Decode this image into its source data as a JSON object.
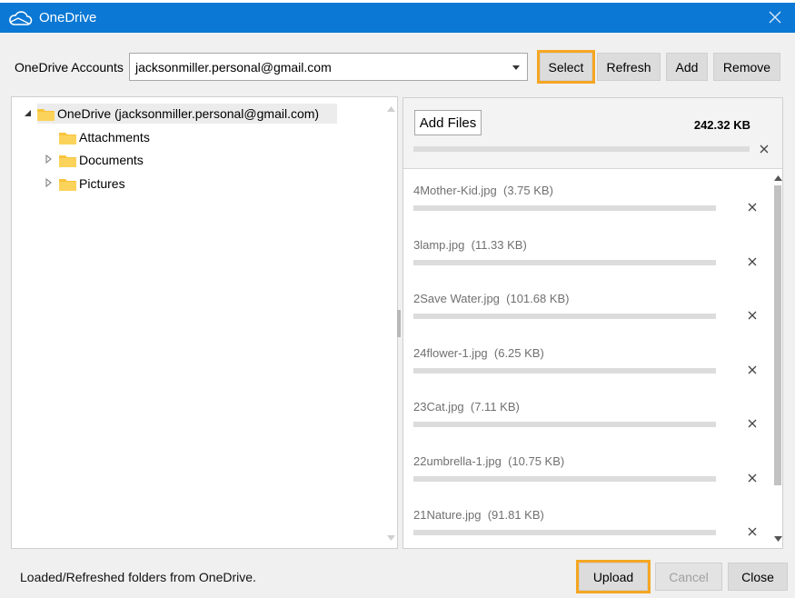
{
  "window": {
    "title": "OneDrive",
    "icon": "cloud-icon",
    "close_icon": "close-icon"
  },
  "accounts": {
    "label": "OneDrive Accounts",
    "selected": "jacksonmiller.personal@gmail.com",
    "buttons": {
      "select": "Select",
      "refresh": "Refresh",
      "add": "Add",
      "remove": "Remove"
    }
  },
  "tree": {
    "root": "OneDrive (jacksonmiller.personal@gmail.com)",
    "children": [
      "Attachments",
      "Documents",
      "Pictures"
    ]
  },
  "upload_panel": {
    "add_files_label": "Add Files",
    "total_size": "242.32 KB",
    "files": [
      {
        "name": "4Mother-Kid.jpg",
        "size": "(3.75 KB)"
      },
      {
        "name": "3lamp.jpg",
        "size": "(11.33 KB)"
      },
      {
        "name": "2Save Water.jpg",
        "size": "(101.68 KB)"
      },
      {
        "name": "24flower-1.jpg",
        "size": "(6.25 KB)"
      },
      {
        "name": "23Cat.jpg",
        "size": "(7.11 KB)"
      },
      {
        "name": "22umbrella-1.jpg",
        "size": "(10.75 KB)"
      },
      {
        "name": "21Nature.jpg",
        "size": "(91.81 KB)"
      }
    ]
  },
  "footer": {
    "status": "Loaded/Refreshed folders from OneDrive.",
    "upload": "Upload",
    "cancel": "Cancel",
    "close": "Close"
  },
  "colors": {
    "titlebar": "#0a78d4",
    "highlight": "#f5a623",
    "folder": "#f8c33c"
  }
}
